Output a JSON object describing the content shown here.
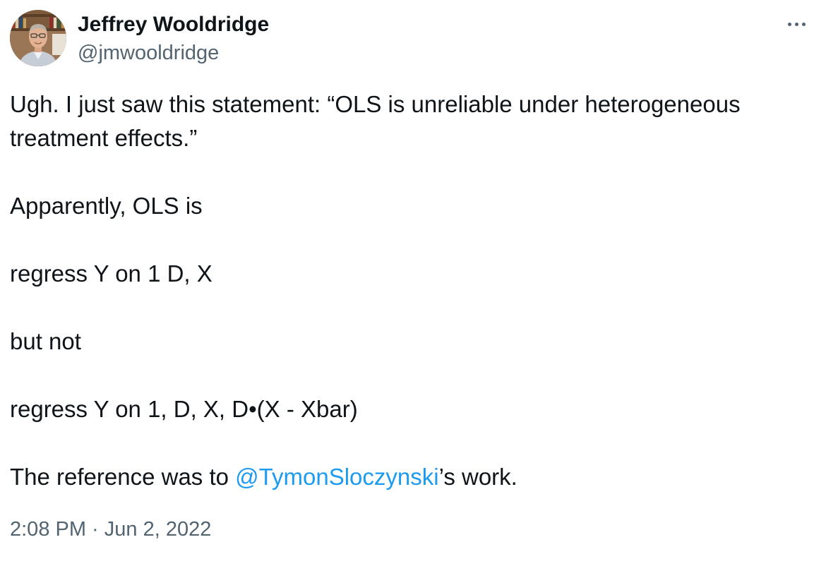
{
  "author": {
    "display_name": "Jeffrey Wooldridge",
    "handle": "@jmwooldridge",
    "avatar_icon": "profile-photo"
  },
  "more_icon": "more-horizontal-icon",
  "tweet": {
    "paragraphs": [
      "Ugh. I just saw this statement: “OLS is unreliable under heterogeneous treatment effects.”",
      "Apparently, OLS is",
      "regress Y on 1 D, X",
      "but not",
      "regress Y on 1, D, X, D•(X - Xbar)"
    ],
    "last_paragraph": {
      "prefix": "The reference was to ",
      "mention": "@TymonSloczynski",
      "suffix": "’s work."
    }
  },
  "meta": {
    "time": "2:08 PM",
    "separator": " · ",
    "date": "Jun 2, 2022"
  },
  "colors": {
    "text": "#0f1419",
    "secondary": "#536471",
    "link": "#1d9bf0"
  }
}
